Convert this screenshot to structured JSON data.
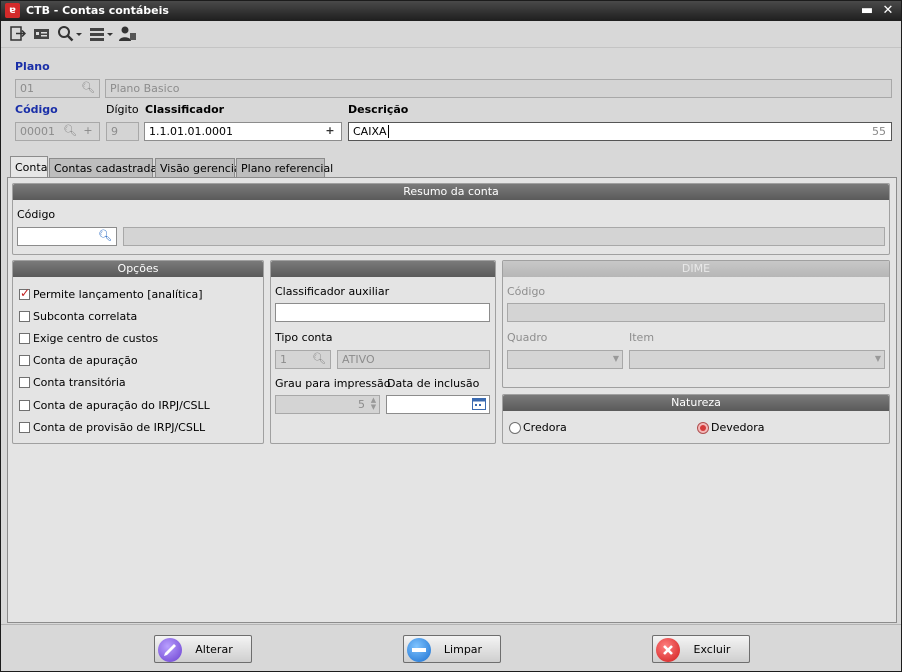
{
  "window": {
    "title": "CTB - Contas contábeis",
    "minimize_glyph": "▬",
    "close_glyph": "✕"
  },
  "toolbar": {
    "icons": [
      "exit-icon",
      "id-card-icon",
      "search-icon",
      "list-icon",
      "user-icon"
    ]
  },
  "header": {
    "plano_label": "Plano",
    "plano_code": "01",
    "plano_desc": "Plano Basico",
    "codigo_label": "Código",
    "codigo_value": "00001",
    "digito_label": "Dígito",
    "digito_value": "9",
    "classificador_label": "Classificador",
    "classificador_value": "1.1.01.01.0001",
    "descricao_label": "Descrição",
    "descricao_value": "CAIXA",
    "descricao_counter": "55"
  },
  "tabs": [
    {
      "label": "Conta"
    },
    {
      "label": "Contas cadastradas"
    },
    {
      "label": "Visão gerencial"
    },
    {
      "label": "Plano referencial"
    }
  ],
  "resumo": {
    "title": "Resumo da conta",
    "codigo_label": "Código",
    "codigo_value": "",
    "desc_value": ""
  },
  "opcoes": {
    "title": "Opções",
    "items": [
      {
        "label": "Permite lançamento [analítica]",
        "checked": true
      },
      {
        "label": "Subconta correlata",
        "checked": false
      },
      {
        "label": "Exige centro de custos",
        "checked": false
      },
      {
        "label": "Conta de apuração",
        "checked": false
      },
      {
        "label": "Conta transitória",
        "checked": false
      },
      {
        "label": "Conta de apuração do IRPJ/CSLL",
        "checked": false
      },
      {
        "label": "Conta de provisão de IRPJ/CSLL",
        "checked": false
      }
    ]
  },
  "middle": {
    "title": "",
    "classificador_aux_label": "Classificador auxiliar",
    "classificador_aux_value": "",
    "tipo_conta_label": "Tipo conta",
    "tipo_conta_code": "1",
    "tipo_conta_desc": "ATIVO",
    "grau_label": "Grau para impressão",
    "grau_value": "5",
    "data_label": "Data de inclusão",
    "data_value": ""
  },
  "dime": {
    "title": "DIME",
    "codigo_label": "Código",
    "quadro_label": "Quadro",
    "item_label": "Item"
  },
  "natureza": {
    "title": "Natureza",
    "options": [
      {
        "label": "Credora",
        "selected": false
      },
      {
        "label": "Devedora",
        "selected": true
      }
    ]
  },
  "buttons": {
    "alterar": "Alterar",
    "limpar": "Limpar",
    "excluir": "Excluir"
  },
  "colors": {
    "accent_blue": "#1a2fa8",
    "group_header": "#6a6a6a",
    "check_red": "#c02020"
  }
}
